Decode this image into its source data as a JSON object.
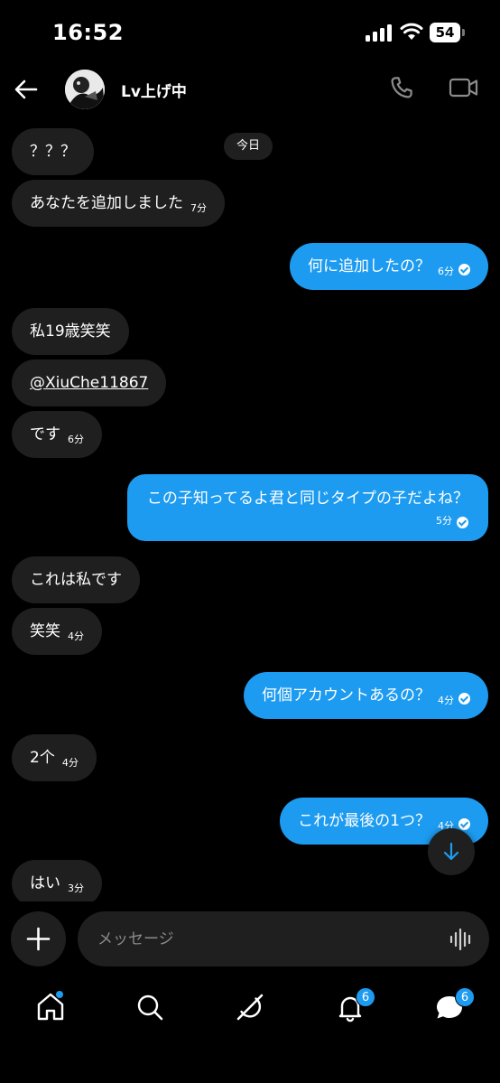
{
  "status": {
    "time": "16:52",
    "battery": "54"
  },
  "header": {
    "title": "Lv上げ中"
  },
  "chat": {
    "day_label": "今日",
    "messages": [
      {
        "text": "？？？",
        "time": ""
      },
      {
        "text": "あなたを追加しました",
        "time": "7分"
      },
      {
        "text": "何に追加したの？",
        "time": "6分"
      },
      {
        "text": "私19歳笑笑",
        "time": ""
      },
      {
        "text": "@XiuChe11867",
        "time": ""
      },
      {
        "text": "です",
        "time": "6分"
      },
      {
        "text": "この子知ってるよ君と同じタイプの子だよね？",
        "time": "5分"
      },
      {
        "text": "これは私です",
        "time": ""
      },
      {
        "text": "笑笑",
        "time": "4分"
      },
      {
        "text": "何個アカウントあるの？",
        "time": "4分"
      },
      {
        "text": "2个",
        "time": "4分"
      },
      {
        "text": "これが最後の1つ？",
        "time": "4分"
      },
      {
        "text": "はい",
        "time": "3分"
      }
    ]
  },
  "composer": {
    "placeholder": "メッセージ"
  },
  "tabs": {
    "notifications_badge": "6",
    "messages_badge": "6"
  },
  "colors": {
    "accent": "#1d9bf0",
    "bubble_in": "#1f1f1f",
    "background": "#000000"
  }
}
